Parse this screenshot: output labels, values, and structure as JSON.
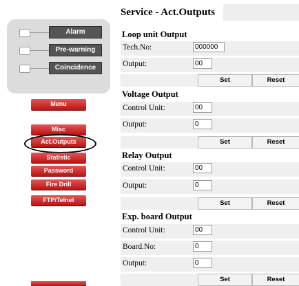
{
  "status": {
    "alarm": "Alarm",
    "prewarning": "Pre-warning",
    "coincidence": "Coincidence"
  },
  "nav": {
    "menu": "Menu",
    "items": [
      "Misc",
      "Act.Outputs",
      "Statistic",
      "Password",
      "Fire Drill",
      "FTP/Telnet"
    ],
    "active": "Act.Outputs"
  },
  "page": {
    "title": "Service - Act.Outputs"
  },
  "sections": {
    "loop": {
      "title": "Loop unit Output",
      "tech_label": "Tech.No:",
      "tech_value": "000000",
      "output_label": "Output:",
      "output_value": "00",
      "set": "Set",
      "reset": "Reset"
    },
    "voltage": {
      "title": "Voltage Output",
      "control_label": "Control Unit:",
      "control_value": "00",
      "output_label": "Output:",
      "output_value": "0",
      "set": "Set",
      "reset": "Reset"
    },
    "relay": {
      "title": "Relay Output",
      "control_label": "Control Unit:",
      "control_value": "00",
      "output_label": "Output:",
      "output_value": "0",
      "set": "Set",
      "reset": "Reset"
    },
    "exp": {
      "title": "Exp. board Output",
      "control_label": "Control Unit:",
      "control_value": "00",
      "board_label": "Board.No:",
      "board_value": "0",
      "output_label": "Output:",
      "output_value": "0",
      "set": "Set",
      "reset": "Reset"
    }
  },
  "colors": {
    "nav_red": "#c82020",
    "status_gray": "#555555",
    "row_bg": "#efefef"
  }
}
